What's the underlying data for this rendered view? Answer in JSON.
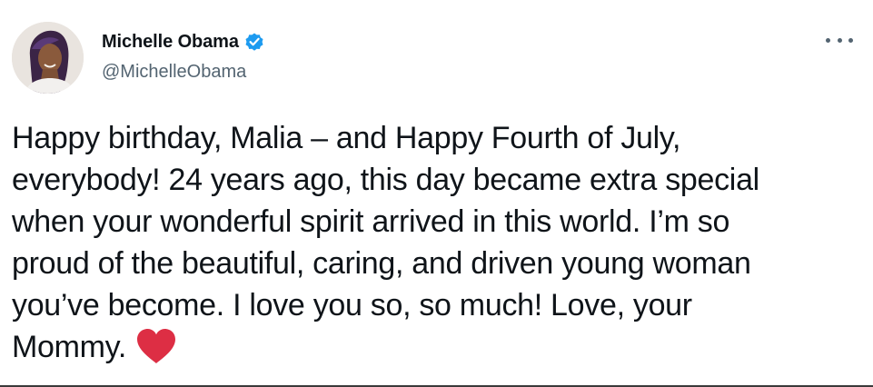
{
  "author": {
    "display_name": "Michelle Obama",
    "handle": "@MichelleObama",
    "verified": true,
    "avatar_icon": "profile-photo"
  },
  "tweet": {
    "text": "Happy birthday, Malia – and Happy Fourth of July,\neverybody! 24 years ago, this day became extra special\nwhen your wonderful spirit arrived in this world. I’m so\nproud of the beautiful, caring, and driven young woman\nyou’ve become. I love you so, so much! Love, your\nMommy.",
    "trailing_emoji": "red-heart-icon"
  },
  "icons": {
    "verified": "verified-badge-icon",
    "more": "more-options-icon"
  },
  "colors": {
    "text": "#0f1419",
    "secondary_text": "#536471",
    "verified_blue": "#1d9bf0",
    "heart_red": "#dd2e44"
  }
}
